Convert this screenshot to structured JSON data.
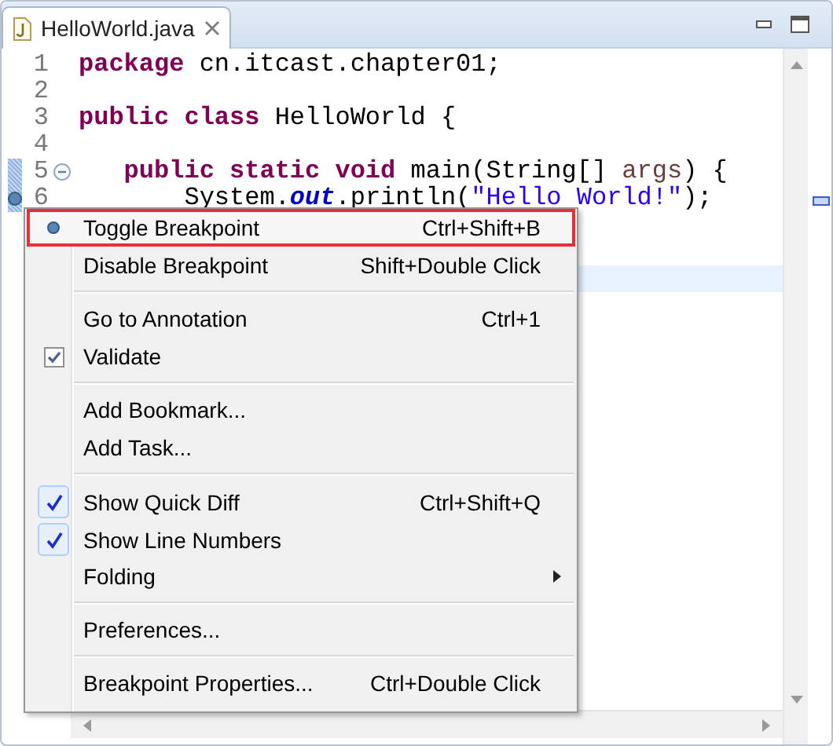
{
  "tab": {
    "title": "HelloWorld.java",
    "selected": true
  },
  "code": {
    "lines": [
      {
        "number": "1",
        "current": false,
        "foldable": false,
        "breakpoint": false,
        "in_range": false,
        "tokens": [
          {
            "kind": "keyword",
            "text": "package"
          },
          {
            "kind": "plain",
            "text": " cn.itcast.chapter01;"
          }
        ]
      },
      {
        "number": "2",
        "current": false,
        "foldable": false,
        "breakpoint": false,
        "in_range": false
      },
      {
        "number": "3",
        "current": false,
        "foldable": false,
        "breakpoint": false,
        "in_range": false,
        "tokens": [
          {
            "kind": "keyword",
            "text": "public class"
          },
          {
            "kind": "plain",
            "text": " HelloWorld {"
          }
        ]
      },
      {
        "number": "4",
        "current": false,
        "foldable": false,
        "breakpoint": false,
        "in_range": false
      },
      {
        "number": "5",
        "current": false,
        "foldable": true,
        "breakpoint": false,
        "in_range": true,
        "tokens": [
          {
            "kind": "keyword",
            "text": "   public static void"
          },
          {
            "kind": "plain",
            "text": " main(String[] "
          },
          {
            "kind": "local",
            "text": "args"
          },
          {
            "kind": "plain",
            "text": ") {"
          }
        ]
      },
      {
        "number": "6",
        "current": false,
        "foldable": false,
        "breakpoint": true,
        "in_range": true,
        "tokens": [
          {
            "kind": "plain",
            "text": "       System."
          },
          {
            "kind": "field",
            "text": "out"
          },
          {
            "kind": "plain",
            "text": ".println("
          },
          {
            "kind": "string",
            "text": "\"Hello World!\""
          },
          {
            "kind": "plain",
            "text": ");"
          }
        ]
      },
      {
        "current": false
      },
      {
        "current": false
      },
      {
        "current": true
      }
    ]
  },
  "context_menu": {
    "items": [
      {
        "kind": "breakpoint",
        "label": "Toggle Breakpoint",
        "shortcut": "Ctrl+Shift+B",
        "selected": true
      },
      {
        "kind": "command",
        "label": "Disable Breakpoint",
        "shortcut": "Shift+Double Click",
        "selected": false
      },
      {
        "kind": "separator"
      },
      {
        "kind": "command",
        "label": "Go to Annotation",
        "shortcut": "Ctrl+1",
        "selected": false
      },
      {
        "kind": "checkbox",
        "label": "Validate",
        "checked": true,
        "selected": false
      },
      {
        "kind": "separator"
      },
      {
        "kind": "command",
        "label": "Add Bookmark...",
        "selected": false
      },
      {
        "kind": "command",
        "label": "Add Task...",
        "selected": false
      },
      {
        "kind": "separator"
      },
      {
        "kind": "toggle",
        "label": "Show Quick Diff",
        "shortcut": "Ctrl+Shift+Q",
        "checked": true,
        "selected": false
      },
      {
        "kind": "toggle",
        "label": "Show Line Numbers",
        "checked": true,
        "selected": false
      },
      {
        "kind": "submenu",
        "label": "Folding",
        "selected": false
      },
      {
        "kind": "separator"
      },
      {
        "kind": "command",
        "label": "Preferences...",
        "selected": false
      },
      {
        "kind": "separator"
      },
      {
        "kind": "command",
        "label": "Breakpoint Properties...",
        "shortcut": "Ctrl+Double Click",
        "selected": false
      }
    ]
  }
}
